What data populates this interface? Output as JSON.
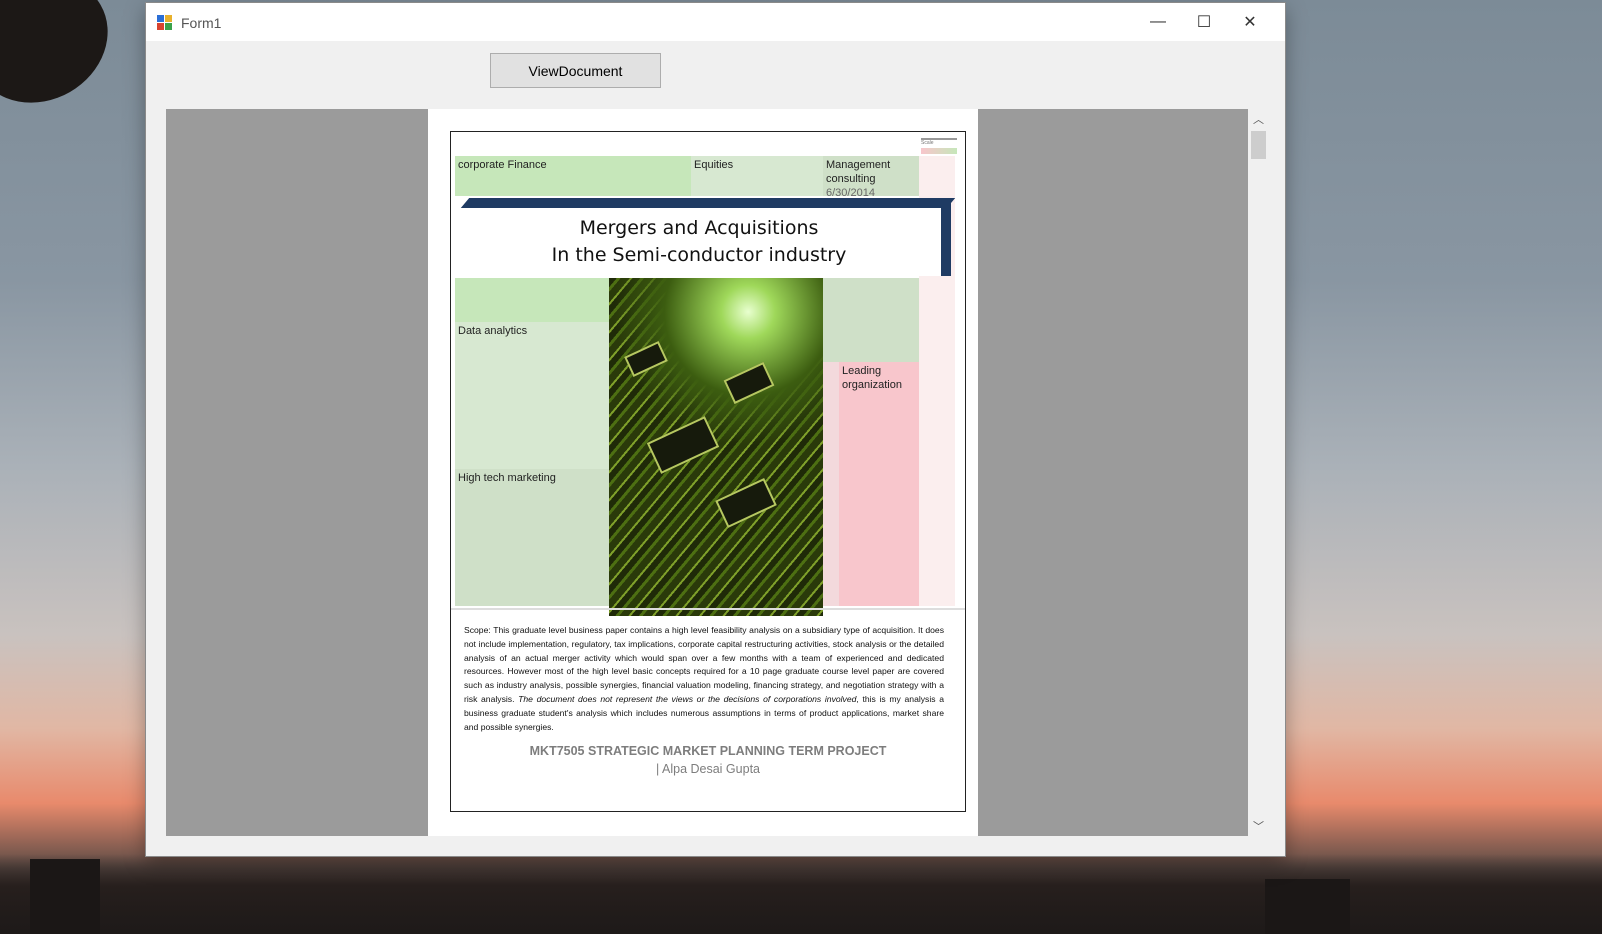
{
  "window": {
    "title": "Form1",
    "controls": {
      "minimize": "—",
      "maximize": "☐",
      "close": "✕"
    }
  },
  "toolbar": {
    "view_document_label": "ViewDocument"
  },
  "document": {
    "tiles": {
      "corporate_finance": "corporate Finance",
      "equities": "Equities",
      "management_consulting_1": "Management",
      "management_consulting_2": "consulting",
      "date": "6/30/2014",
      "data_analytics": "Data analytics",
      "high_tech_marketing": "High tech marketing",
      "leading_org_1": "Leading",
      "leading_org_2": "organization",
      "scale": "Scale"
    },
    "title_line1": "Mergers and Acquisitions",
    "title_line2": "In the Semi-conductor industry",
    "scope_part1": "Scope: This graduate level business paper contains a high level feasibility analysis on a subsidiary type of acquisition. It does not include implementation, regulatory, tax implications, corporate capital restructuring activities, stock analysis or the detailed analysis of an actual merger activity which would span over a few months with a team of experienced and dedicated resources. However most of the high level basic concepts required for a 10 page graduate course level paper are covered such as industry analysis, possible synergies, financial valuation modeling, financing strategy, and negotiation strategy with a risk analysis.",
    "scope_italic": "The document does not represent the views or the decisions of corporations involved",
    "scope_part2": ", this is my analysis a business graduate student's analysis which includes numerous assumptions in terms of product applications, market share and possible synergies.",
    "footer_line1": "MKT7505 STRATEGIC MARKET PLANNING TERM PROJECT",
    "footer_line2": "| Alpa  Desai Gupta"
  },
  "scrollbar": {
    "up_icon": "chevron-up-icon",
    "down_icon": "chevron-down-icon",
    "up": "︿",
    "down": "﹀"
  },
  "colors": {
    "banner": "#1f3b63",
    "window_bg": "#f0f0f0",
    "viewer_bg": "#9b9b9b"
  }
}
